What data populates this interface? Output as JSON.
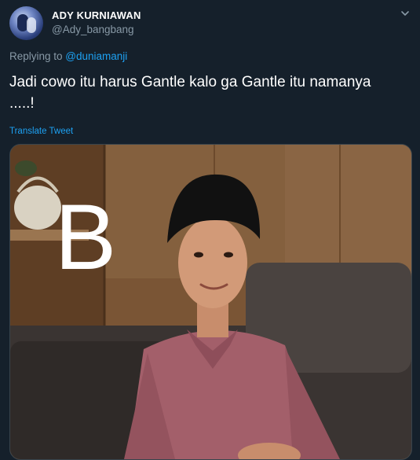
{
  "tweet": {
    "author_name": "ADY KURNIAWAN",
    "author_handle": "@Ady_bangbang",
    "replying_to_prefix": "Replying to ",
    "replying_to_handle": "@duniamanji",
    "text_line1": "Jadi cowo itu harus Gantle kalo ga Gantle itu namanya",
    "text_line2": ".....!",
    "translate_label": "Translate Tweet",
    "image_overlay_letter": "B",
    "icons": {
      "avatar": "avatar",
      "menu": "chevron-down-icon"
    }
  },
  "colors": {
    "background": "#15202b",
    "text_primary": "#ffffff",
    "text_secondary": "#8899a6",
    "accent": "#1da1f2",
    "border": "#38444d"
  }
}
